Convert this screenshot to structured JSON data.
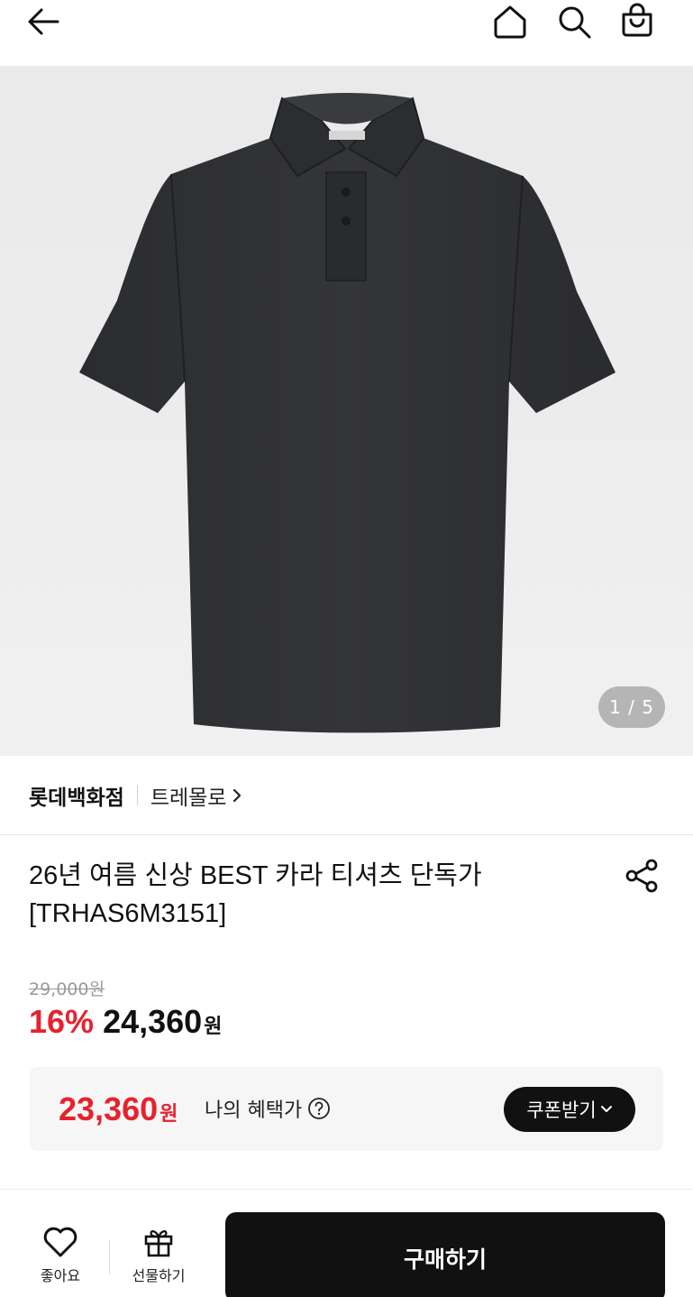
{
  "header": {
    "back_icon": "arrow-left-icon",
    "home_icon": "home-icon",
    "search_icon": "search-icon",
    "bag_icon": "shopping-bag-icon"
  },
  "gallery": {
    "current": "1 / 5"
  },
  "store": {
    "name": "롯데백화점",
    "brand": "트레몰로"
  },
  "product": {
    "title_line1": "26년 여름 신상 BEST 카라 티셔츠 단독가",
    "title_line2": "[TRHAS6M3151]",
    "original_price": "29,000원",
    "discount_rate": "16%",
    "sale_price": "24,360",
    "currency": "원"
  },
  "benefit": {
    "amount": "23,360",
    "currency": "원",
    "label": "나의 혜택가",
    "coupon_button": "쿠폰받기"
  },
  "bottom_bar": {
    "like_label": "좋아요",
    "gift_label": "선물하기",
    "buy_label": "구매하기"
  },
  "colors": {
    "accent_red": "#e6222e",
    "button_black": "#111111"
  }
}
